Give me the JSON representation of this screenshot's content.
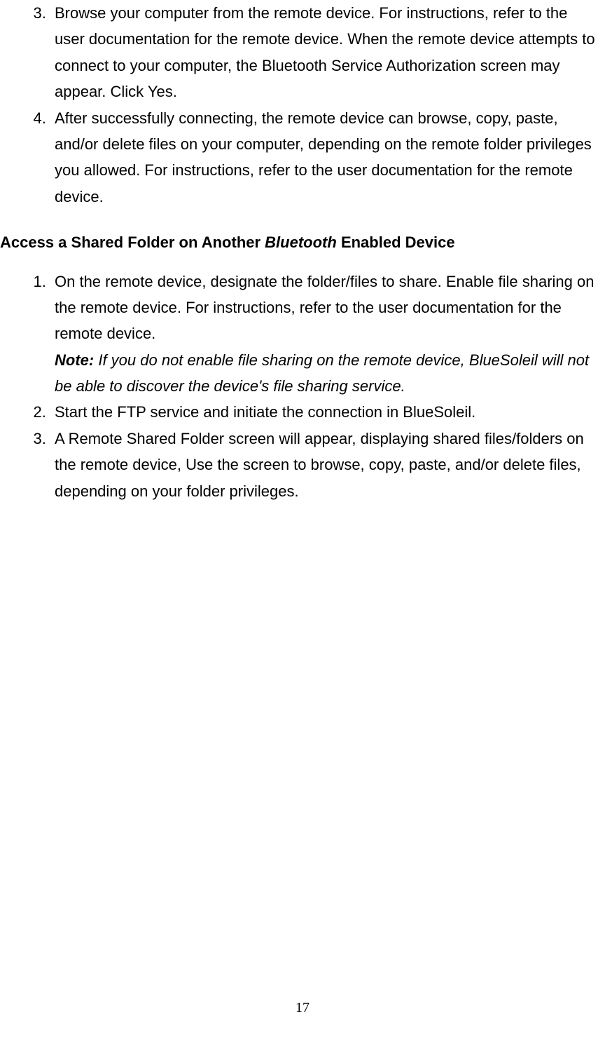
{
  "list1": {
    "start": 3,
    "items": [
      "Browse your computer from the remote device. For instructions, refer to the user documentation for the remote device. When the remote device attempts to connect to your computer, the Bluetooth Service Authorization screen may appear. Click Yes.",
      "After successfully connecting, the remote device can browse, copy, paste, and/or delete files on your computer, depending on the remote folder privileges you allowed. For instructions, refer to the user documentation for the remote device."
    ]
  },
  "heading": {
    "prefix": "Access a Shared Folder on Another ",
    "italic": "Bluetooth",
    "suffix": " Enabled Device"
  },
  "list2": {
    "start": 1,
    "items": [
      {
        "main": "On the remote device, designate the folder/files to share. Enable file sharing on the remote device. For instructions, refer to the user documentation for the remote device.",
        "note_label": "Note:",
        "note_text": " If you do not enable file sharing on the remote device, BlueSoleil will not be able to discover the device's file sharing service."
      },
      {
        "main": "Start the FTP service and initiate the connection in BlueSoleil."
      },
      {
        "main": "A Remote Shared Folder screen will appear, displaying shared files/folders on the remote device, Use the screen to browse, copy, paste, and/or delete files, depending on your folder privileges."
      }
    ]
  },
  "page_number": "17"
}
